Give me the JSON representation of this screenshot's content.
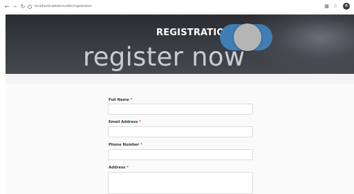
{
  "browser": {
    "back_icon": "arrow-left-icon",
    "forward_icon": "arrow-right-icon",
    "reload_icon": "reload-icon",
    "url": "localhost/rablo/traveller/registration"
  },
  "hero": {
    "title": "REGISTRATION",
    "subtitle": "register now",
    "toggle_color": "#3f7fb6"
  },
  "form": {
    "fields": [
      {
        "label": "Full Name",
        "required_mark": "*",
        "value": ""
      },
      {
        "label": "Email Address",
        "required_mark": "*",
        "value": ""
      },
      {
        "label": "Phone Number",
        "required_mark": "*",
        "value": ""
      },
      {
        "label": "Address",
        "required_mark": "*",
        "value": ""
      }
    ]
  }
}
